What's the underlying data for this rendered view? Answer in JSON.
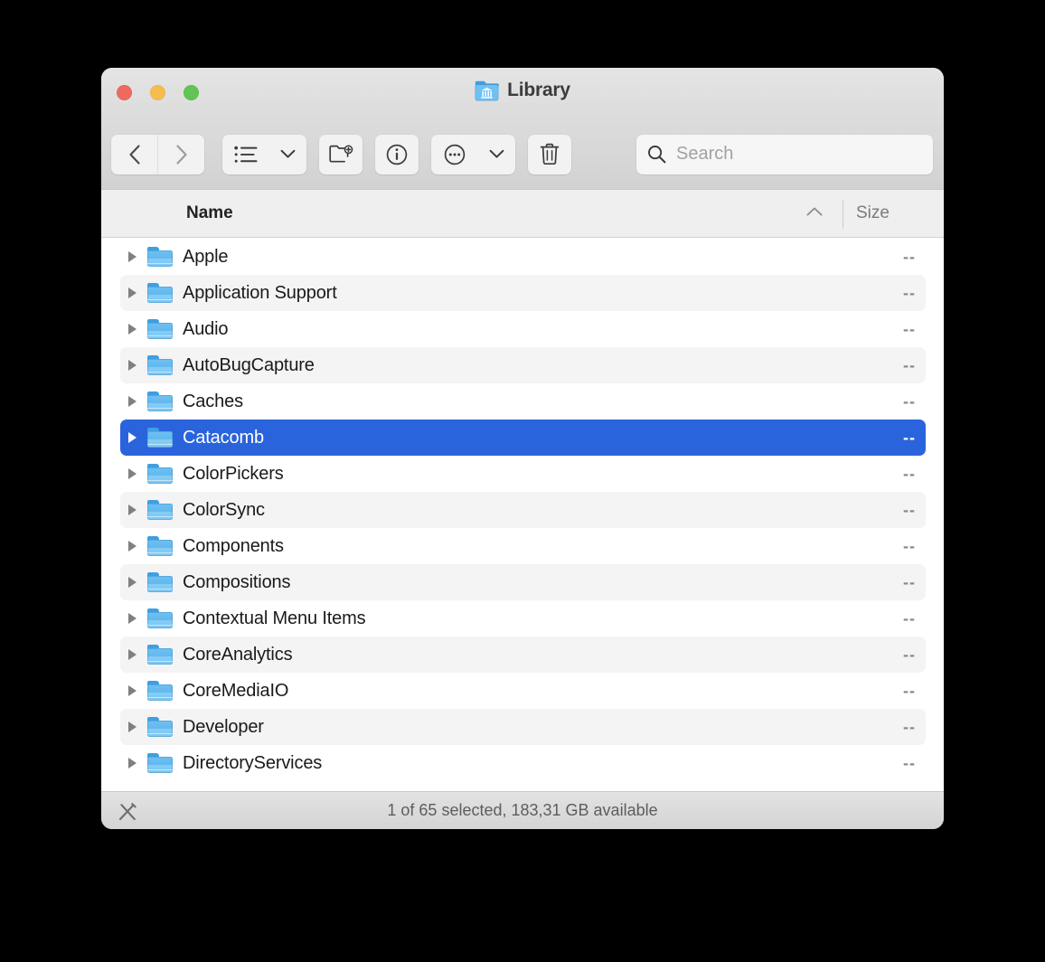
{
  "window": {
    "title": "Library",
    "title_icon": "library-folder-icon",
    "traffic_lights": [
      {
        "name": "close-button",
        "color": "#ec6a5e"
      },
      {
        "name": "minimize-button",
        "color": "#f5bd4f"
      },
      {
        "name": "maximize-button",
        "color": "#61c454"
      }
    ]
  },
  "toolbar": {
    "back_icon": "chevron-left-icon",
    "forward_icon": "chevron-right-icon",
    "view_list_icon": "list-view-icon",
    "view_caret_icon": "chevron-down-icon",
    "new_folder_icon": "new-folder-icon",
    "info_icon": "info-circle-icon",
    "more_icon": "ellipsis-circle-icon",
    "more_caret_icon": "chevron-down-icon",
    "delete_icon": "trash-icon"
  },
  "search": {
    "icon": "search-icon",
    "placeholder": "Search",
    "value": ""
  },
  "columns": {
    "name": "Name",
    "size": "Size",
    "sort_icon": "chevron-up-icon",
    "sort_direction": "ascending",
    "sort_column": "Name"
  },
  "files": [
    {
      "name": "Apple",
      "size": "--",
      "icon": "folder-icon",
      "selected": false,
      "stripe": false
    },
    {
      "name": "Application Support",
      "size": "--",
      "icon": "folder-icon",
      "selected": false,
      "stripe": true
    },
    {
      "name": "Audio",
      "size": "--",
      "icon": "folder-icon",
      "selected": false,
      "stripe": false
    },
    {
      "name": "AutoBugCapture",
      "size": "--",
      "icon": "folder-icon",
      "selected": false,
      "stripe": true
    },
    {
      "name": "Caches",
      "size": "--",
      "icon": "folder-icon",
      "selected": false,
      "stripe": false
    },
    {
      "name": "Catacomb",
      "size": "--",
      "icon": "folder-icon",
      "selected": true,
      "stripe": true
    },
    {
      "name": "ColorPickers",
      "size": "--",
      "icon": "folder-icon",
      "selected": false,
      "stripe": false
    },
    {
      "name": "ColorSync",
      "size": "--",
      "icon": "folder-icon",
      "selected": false,
      "stripe": true
    },
    {
      "name": "Components",
      "size": "--",
      "icon": "folder-icon",
      "selected": false,
      "stripe": false
    },
    {
      "name": "Compositions",
      "size": "--",
      "icon": "folder-icon",
      "selected": false,
      "stripe": true
    },
    {
      "name": "Contextual Menu Items",
      "size": "--",
      "icon": "folder-icon",
      "selected": false,
      "stripe": false
    },
    {
      "name": "CoreAnalytics",
      "size": "--",
      "icon": "folder-icon",
      "selected": false,
      "stripe": true
    },
    {
      "name": "CoreMediaIO",
      "size": "--",
      "icon": "folder-icon",
      "selected": false,
      "stripe": false
    },
    {
      "name": "Developer",
      "size": "--",
      "icon": "folder-icon",
      "selected": false,
      "stripe": true
    },
    {
      "name": "DirectoryServices",
      "size": "--",
      "icon": "folder-icon",
      "selected": false,
      "stripe": false
    }
  ],
  "status": {
    "markup_icon": "markup-pen-icon",
    "text": "1 of 65 selected, 183,31 GB available"
  },
  "colors": {
    "selection_blue": "#2a64dc",
    "folder_blue": "#62b8ee",
    "stripe_gray": "#f4f4f5",
    "toolbar_gray": "#d6d6d6"
  }
}
